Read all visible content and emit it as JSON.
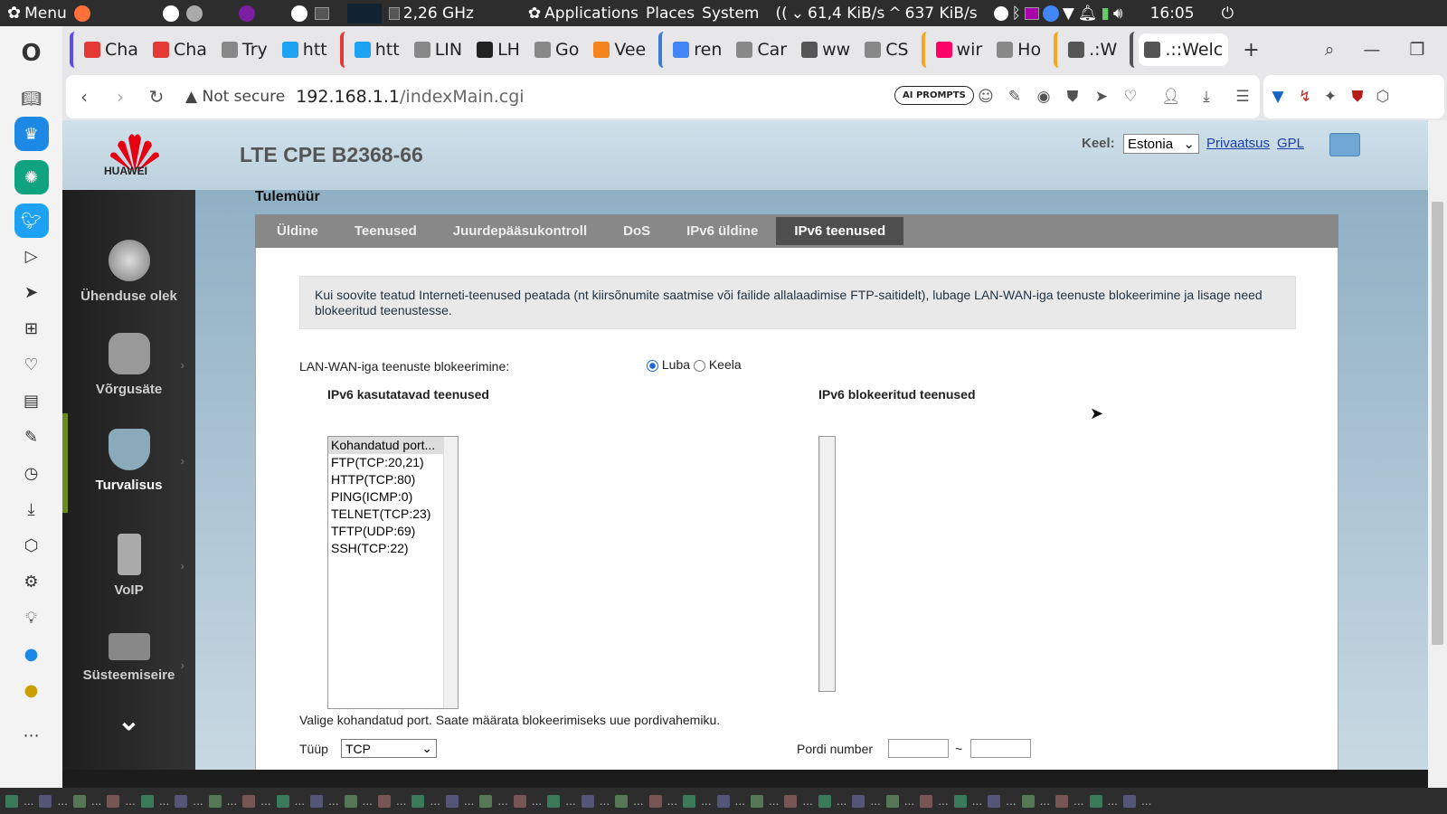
{
  "os": {
    "menu_label": "Menu",
    "cpu_freq": "2,26 GHz",
    "applications": "Applications",
    "places": "Places",
    "system": "System",
    "net_down": "61,4 KiB/s",
    "net_up": "637 KiB/s",
    "clock": "16:05"
  },
  "browser": {
    "tabs": [
      {
        "label": "Cha",
        "color": "#e53935"
      },
      {
        "label": "Cha",
        "color": "#e53935"
      },
      {
        "label": "Try",
        "color": "#888"
      },
      {
        "label": "htt",
        "color": "#1da1f2"
      },
      {
        "label": "LIN",
        "color": "#888"
      },
      {
        "label": "LH",
        "color": "#222"
      },
      {
        "label": "Go",
        "color": "#888"
      },
      {
        "label": "Vee",
        "color": "#f5841f"
      },
      {
        "label": "ren",
        "color": "#4285f4"
      },
      {
        "label": "Car",
        "color": "#888"
      },
      {
        "label": "ww",
        "color": "#555"
      },
      {
        "label": "CS",
        "color": "#888"
      },
      {
        "label": "wir",
        "color": "#f06"
      },
      {
        "label": "Ho",
        "color": "#888"
      },
      {
        "label": ".:W",
        "color": "#555"
      },
      {
        "label": ".::Welc",
        "color": "#555"
      }
    ],
    "security_label": "Not secure",
    "url_host": "192.168.1.1",
    "url_path": "/indexMain.cgi",
    "ai_prompts": "AI PROMPTS"
  },
  "router": {
    "brand": "HUAWEI",
    "product": "LTE CPE B2368-66",
    "lang_label": "Keel:",
    "lang_value": "Estonia",
    "privacy_link": "Privaatsus",
    "gpl_link": "GPL",
    "sidebar": [
      {
        "label": "Ühenduse olek"
      },
      {
        "label": "Võrgusäte"
      },
      {
        "label": "Turvalisus"
      },
      {
        "label": "VoIP"
      },
      {
        "label": "Süsteemiseire"
      }
    ],
    "section_title": "Tulemüür",
    "tabs": [
      "Üldine",
      "Teenused",
      "Juurdepääsukontroll",
      "DoS",
      "IPv6 üldine",
      "IPv6 teenused"
    ],
    "notice": "Kui soovite teatud Interneti-teenused peatada (nt kiirsõnumite saatmise või failide allalaadimise FTP-saitidelt), lubage LAN-WAN-iga teenuste blokeerimine ja lisage need blokeeritud teenustesse.",
    "blocking_label": "LAN-WAN-iga teenuste blokeerimine:",
    "allow_label": "Luba",
    "deny_label": "Keela",
    "available_title": "IPv6 kasutatavad teenused",
    "blocked_title": "IPv6 blokeeritud teenused",
    "available_services": [
      "Kohandatud port...",
      "FTP(TCP:20,21)",
      "HTTP(TCP:80)",
      "PING(ICMP:0)",
      "TELNET(TCP:23)",
      "TFTP(UDP:69)",
      "SSH(TCP:22)"
    ],
    "hint": "Valige kohandatud port. Saate määrata blokeerimiseks uue pordivahemiku.",
    "type_label": "Tüüp",
    "type_value": "TCP",
    "port_label": "Pordi number",
    "port_sep": "~"
  }
}
